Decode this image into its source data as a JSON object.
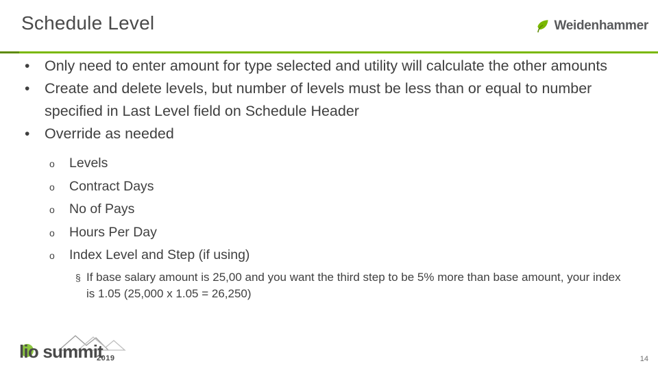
{
  "header": {
    "title": "Schedule Level",
    "brand_name": "Weidenhammer",
    "brand_icon": "leaf-icon",
    "accent_color": "#7ab800"
  },
  "content": {
    "bullets": [
      {
        "marker": "•",
        "text": "Only need to enter amount for type selected and utility will calculate the other amounts"
      },
      {
        "marker": "•",
        "text": "Create and delete levels, but number of levels must be less than or equal to number specified in Last Level field on Schedule Header"
      },
      {
        "marker": "•",
        "text": "Override as needed"
      }
    ],
    "sub_bullets": [
      {
        "marker": "o",
        "text": "Levels"
      },
      {
        "marker": "o",
        "text": "Contract Days"
      },
      {
        "marker": "o",
        "text": "No of Pays"
      },
      {
        "marker": "o",
        "text": "Hours Per Day"
      },
      {
        "marker": "o",
        "text": "Index Level and Step (if using)"
      }
    ],
    "sub_sub_bullets": [
      {
        "marker": "§",
        "text": "If base salary amount is 25,00 and you want the third step to be 5% more than base amount, your index is 1.05 (25,000 x 1.05 = 26,250)"
      }
    ]
  },
  "footer": {
    "logo_word": "lio summit",
    "logo_year": "2019",
    "page_number": "14",
    "logo_dot_color": "#8cc63f"
  }
}
